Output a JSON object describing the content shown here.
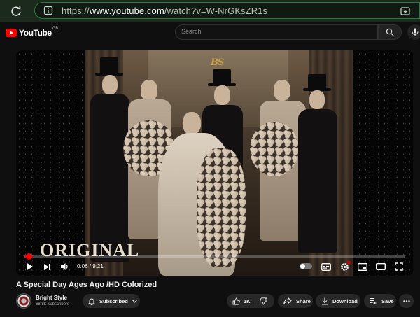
{
  "browser": {
    "url_prefix": "https://",
    "url_host": "www.youtube.com",
    "url_path": "/watch?v=W-NrGKsZR1s"
  },
  "header": {
    "logo_text": "YouTube",
    "region": "GB",
    "search_placeholder": "Search"
  },
  "player": {
    "overlay_logo": "BS",
    "watermark": "ORIGINAL",
    "current_time": "0:06",
    "duration": "9:21",
    "progress_fraction": 0.011,
    "accent_color": "#ff0000"
  },
  "video": {
    "title": "A Special Day Ages Ago /HD Colorized",
    "channel_name": "Bright Style",
    "subscribers": "68.8K subscribers"
  },
  "actions": {
    "subscribed_label": "Subscribed",
    "likes": "1K",
    "share_label": "Share",
    "download_label": "Download",
    "save_label": "Save"
  }
}
